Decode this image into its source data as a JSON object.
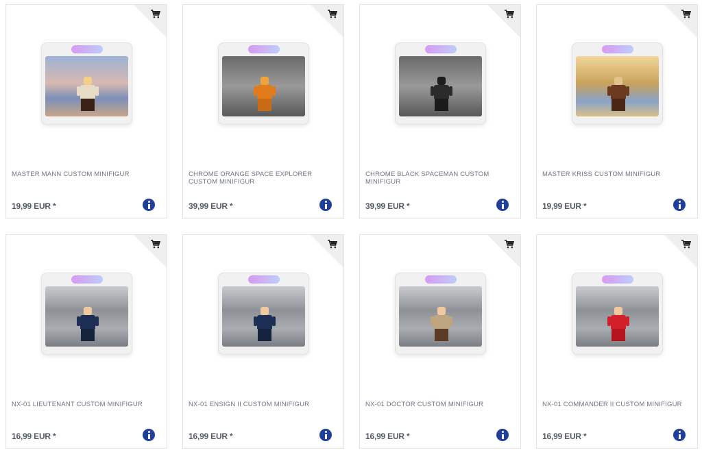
{
  "colors": {
    "price": "#545b66",
    "title": "#6c7482",
    "info_icon": "#1f3f9a",
    "card_border": "#e3e3e3"
  },
  "icons": {
    "cart": "shopping-cart-icon",
    "info": "info-icon"
  },
  "products": [
    {
      "title": "MASTER MANN CUSTOM MINIFIGUR",
      "price": "19,99 EUR *",
      "backdrop": "sunset",
      "figure": "tan"
    },
    {
      "title": "CHROME ORANGE SPACE EXPLORER CUSTOM MINIFIGUR",
      "price": "39,99 EUR *",
      "backdrop": "gray",
      "figure": "orange"
    },
    {
      "title": "CHROME BLACK SPACEMAN CUSTOM MINIFIGUR",
      "price": "39,99 EUR *",
      "backdrop": "gray",
      "figure": "black"
    },
    {
      "title": "MASTER KRISS CUSTOM MINIFIGUR",
      "price": "19,99 EUR *",
      "backdrop": "gold",
      "figure": "brown"
    },
    {
      "title": "NX-01 LIEUTENANT CUSTOM MINIFIGUR",
      "price": "16,99 EUR *",
      "backdrop": "ship",
      "figure": "blue"
    },
    {
      "title": "NX-01 ENSIGN II CUSTOM MINIFIGUR",
      "price": "16,99 EUR *",
      "backdrop": "ship",
      "figure": "blue"
    },
    {
      "title": "NX-01 DOCTOR CUSTOM MINIFIGUR",
      "price": "16,99 EUR *",
      "backdrop": "ship",
      "figure": "khaki"
    },
    {
      "title": "NX-01 COMMANDER II CUSTOM MINIFIGUR",
      "price": "16,99 EUR *",
      "backdrop": "ship",
      "figure": "red"
    }
  ]
}
